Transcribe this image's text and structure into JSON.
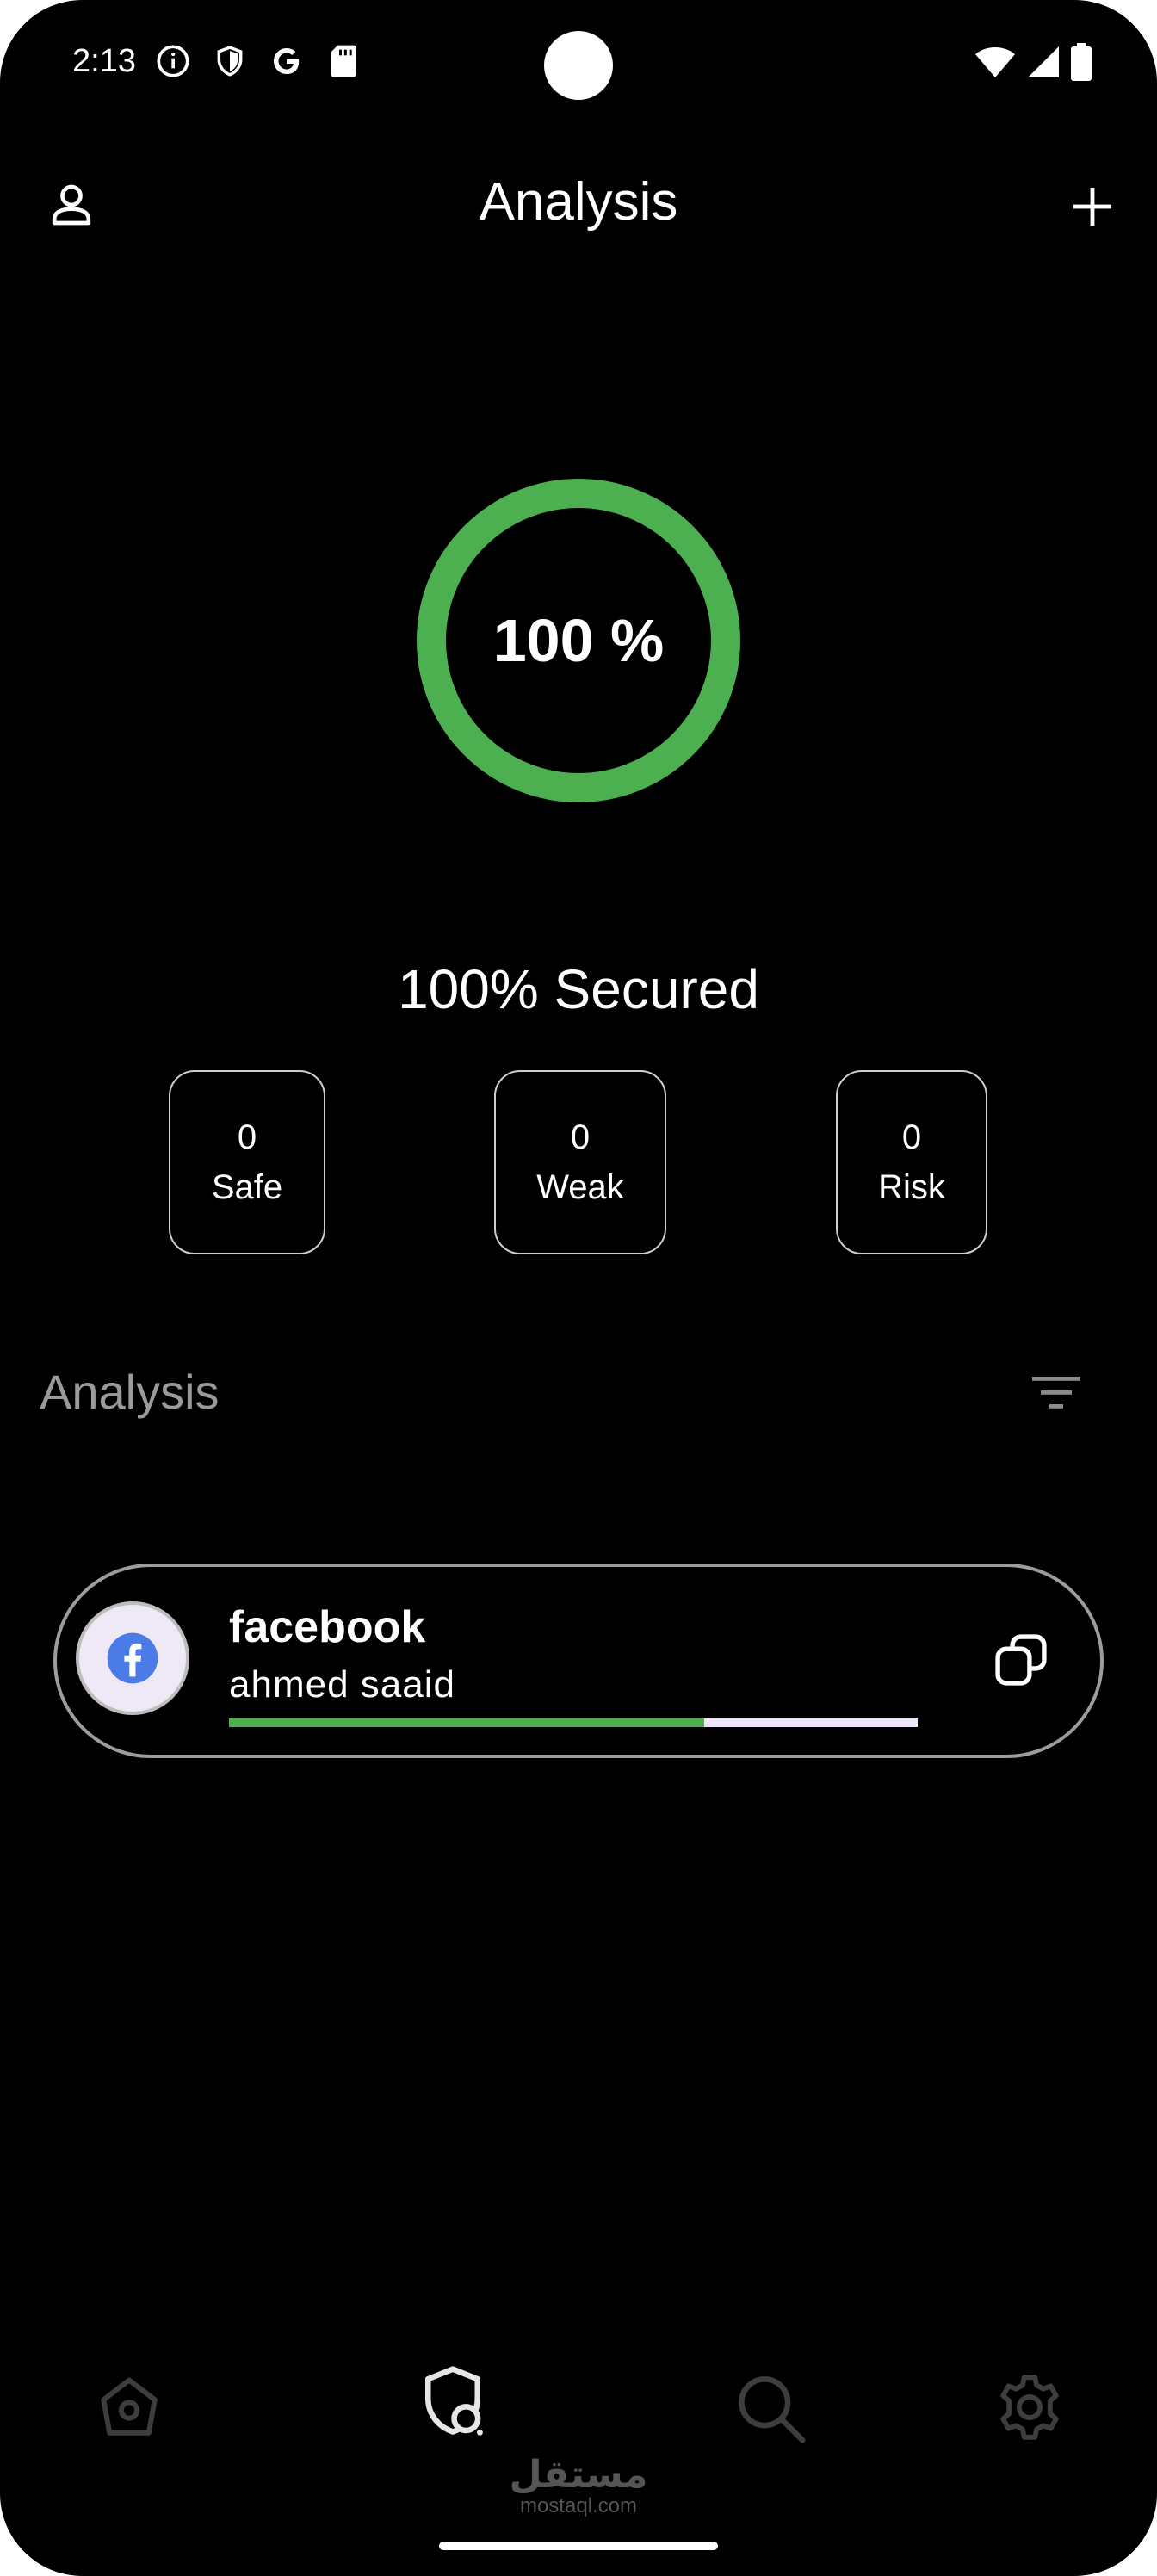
{
  "status_bar": {
    "time": "2:13",
    "left_icons": [
      "info-icon",
      "shield-icon",
      "google-icon",
      "sd-card-icon"
    ],
    "right_icons": [
      "wifi-icon",
      "signal-icon",
      "battery-icon"
    ]
  },
  "header": {
    "title": "Analysis"
  },
  "gauge": {
    "value_text": "100 %",
    "percent": 100,
    "color": "#4caf50"
  },
  "summary": {
    "secured_text": "100% Secured"
  },
  "stats": [
    {
      "count": "0",
      "label": "Safe"
    },
    {
      "count": "0",
      "label": "Weak"
    },
    {
      "count": "0",
      "label": "Risk"
    }
  ],
  "section": {
    "title": "Analysis"
  },
  "accounts": [
    {
      "name": "facebook",
      "username": "ahmed saaid",
      "strength": 0.69,
      "strength_color": "#4caf50",
      "track_color": "#f0e6fa",
      "icon": "facebook-icon"
    }
  ],
  "bottom_nav": {
    "items": [
      "home-icon",
      "analysis-icon",
      "search-icon",
      "settings-icon"
    ],
    "active": "analysis-icon"
  },
  "watermark": {
    "arabic": "مستقل",
    "site": "mostaql.com"
  }
}
